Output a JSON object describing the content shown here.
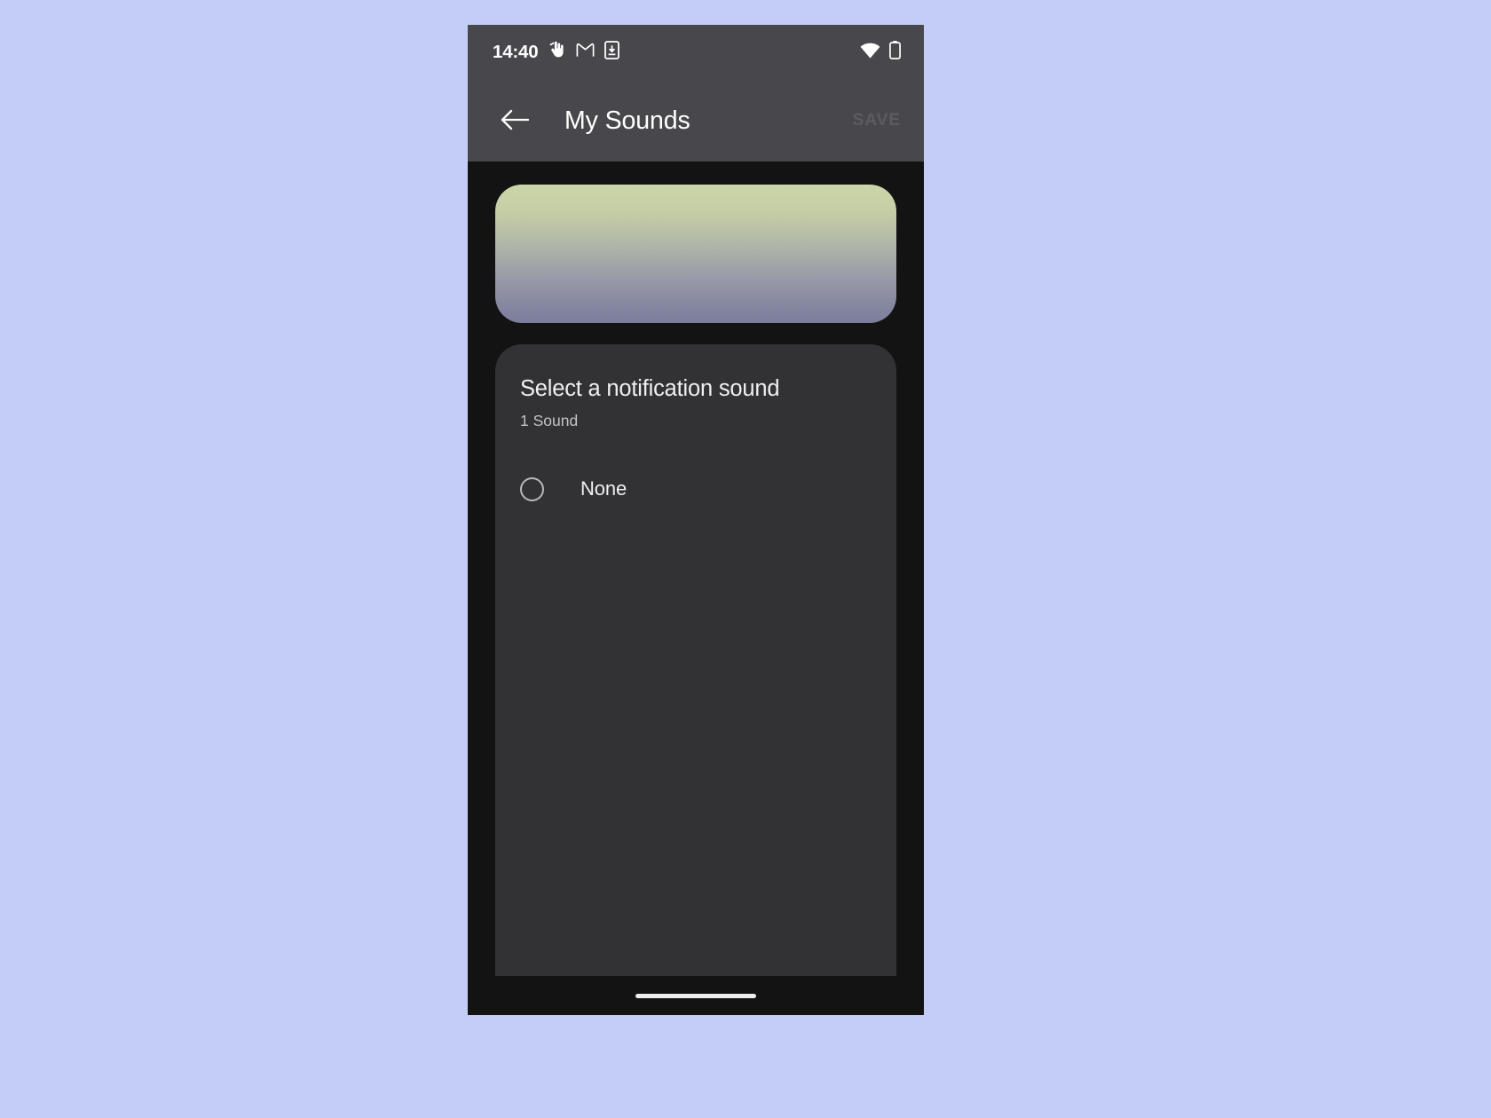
{
  "background_color": "#c3cdf5",
  "status_bar": {
    "time": "14:40",
    "left_icons": [
      "tap-hand-icon",
      "gmail-icon",
      "app-install-icon"
    ],
    "right_icons": [
      "wifi-icon",
      "battery-icon"
    ],
    "background": "#48484c"
  },
  "app_bar": {
    "back_icon": "arrow-left-icon",
    "title": "My Sounds",
    "save_label": "SAVE",
    "save_color": "#5b5b60",
    "background": "#48484c"
  },
  "preview_banner": {
    "gradient_top": "#ccd5a8",
    "gradient_bottom": "#7b7d9c"
  },
  "sound_card": {
    "title": "Select a notification sound",
    "subtitle": "1 Sound",
    "background": "#323235",
    "items": [
      {
        "label": "None",
        "selected": false
      }
    ]
  },
  "fab": {
    "icon": "plus-icon",
    "color": "#c6c8ee",
    "highlight_color": "#22ee22"
  },
  "nav_bar": {
    "gesture_pill": "home-gesture-pill"
  }
}
